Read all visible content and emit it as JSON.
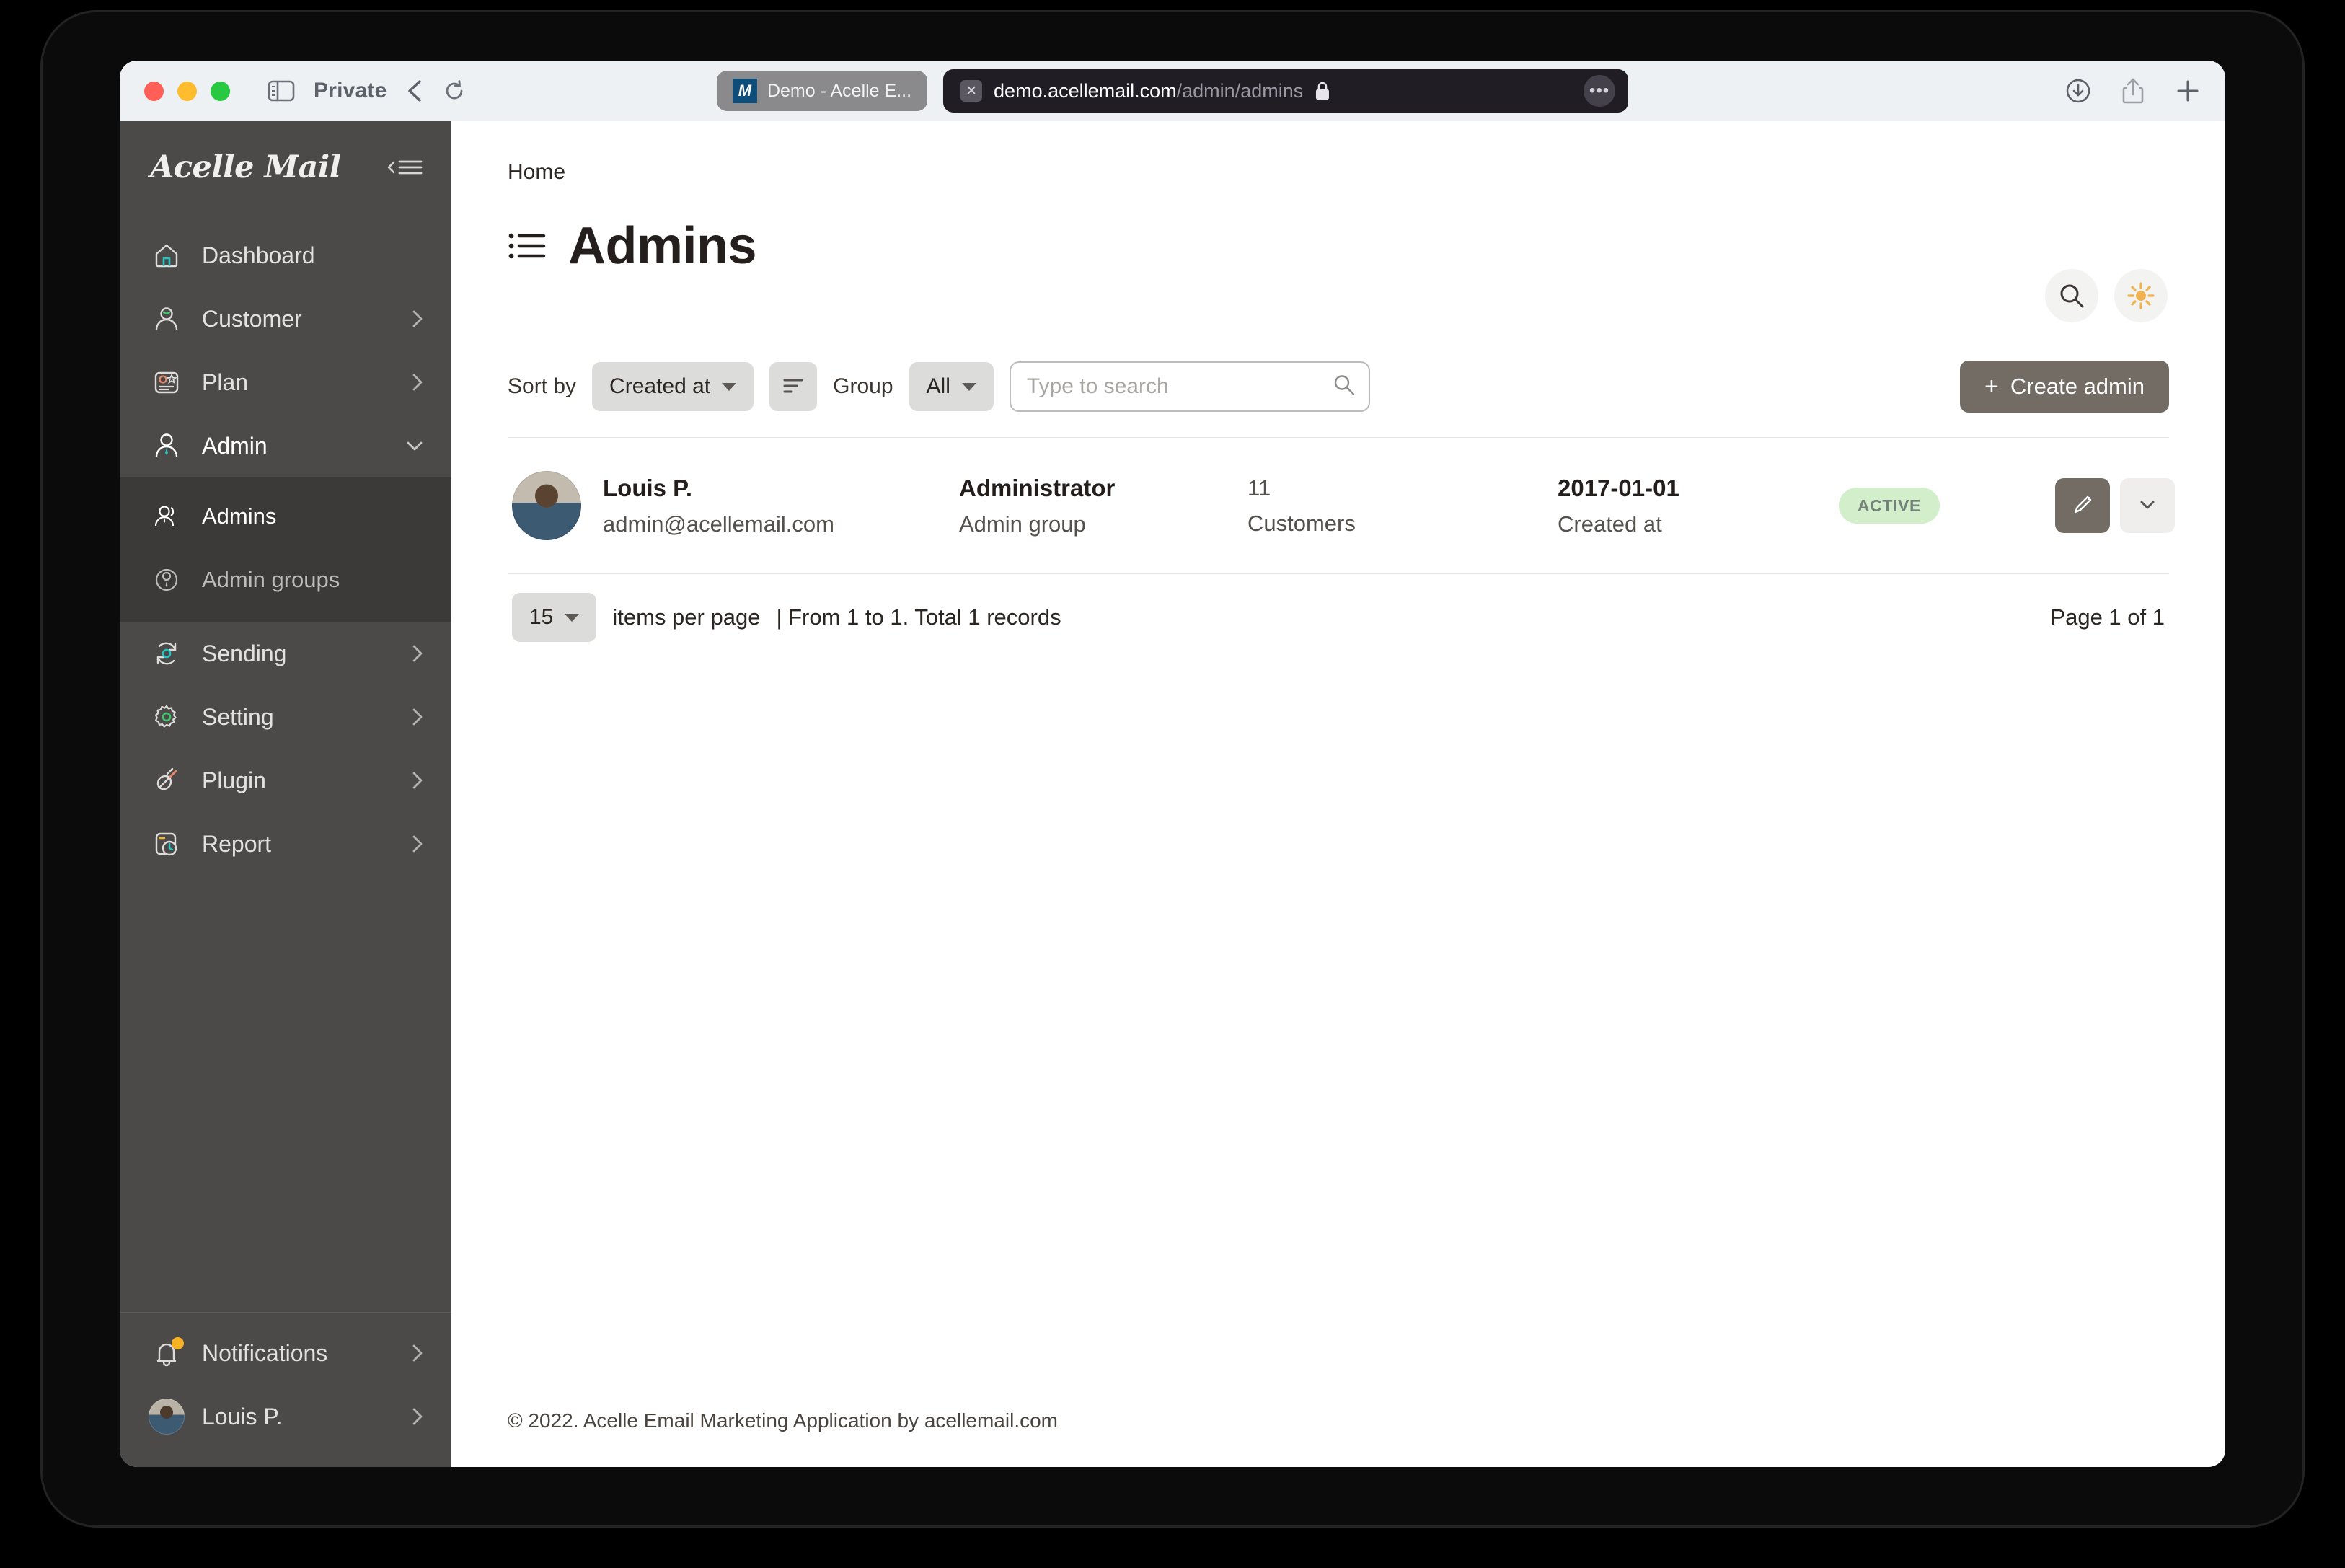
{
  "browser": {
    "private_label": "Private",
    "back_icon": "chevron-left-icon",
    "reload_icon": "reload-icon",
    "sidebar_icon": "sidebar-toggle-icon",
    "tab": {
      "title": "Demo - Acelle E...",
      "favicon_letter": "M"
    },
    "url": {
      "domain": "demo.acellemail.com",
      "path": "/admin/admins",
      "lock_icon": "lock-icon",
      "close_icon": "close-icon",
      "menu_icon": "ellipsis-icon"
    },
    "right_icons": [
      "download-icon",
      "share-icon",
      "new-tab-icon"
    ]
  },
  "sidebar": {
    "brand": "Acelle Mail",
    "collapse_icon": "collapse-sidebar-icon",
    "items": [
      {
        "label": "Dashboard",
        "icon": "home-icon",
        "chevron": ""
      },
      {
        "label": "Customer",
        "icon": "user-icon",
        "chevron": "right"
      },
      {
        "label": "Plan",
        "icon": "plan-card-icon",
        "chevron": "right"
      },
      {
        "label": "Admin",
        "icon": "admin-user-icon",
        "chevron": "down",
        "expanded": true
      },
      {
        "label": "Sending",
        "icon": "sending-sync-icon",
        "chevron": "right"
      },
      {
        "label": "Setting",
        "icon": "gear-icon",
        "chevron": "right"
      },
      {
        "label": "Plugin",
        "icon": "plugin-icon",
        "chevron": "right"
      },
      {
        "label": "Report",
        "icon": "report-clock-icon",
        "chevron": "right"
      }
    ],
    "submenu": [
      {
        "label": "Admins",
        "icon": "admins-icon",
        "active": true
      },
      {
        "label": "Admin groups",
        "icon": "admin-groups-icon",
        "active": false
      }
    ],
    "footer": [
      {
        "label": "Notifications",
        "icon": "bell-icon",
        "chevron": "right",
        "badge": true
      },
      {
        "label": "Louis P.",
        "icon": "avatar",
        "chevron": "right"
      }
    ]
  },
  "header": {
    "breadcrumb": "Home",
    "title": "Admins",
    "title_icon": "list-icon",
    "search_icon": "search-icon",
    "theme_icon": "sun-icon"
  },
  "toolbar": {
    "sort_label": "Sort by",
    "sort_value": "Created at",
    "sort_order_icon": "sort-descending-icon",
    "group_label": "Group",
    "group_value": "All",
    "search_placeholder": "Type to search",
    "search_value": "",
    "create_label": "Create admin",
    "create_plus": "+"
  },
  "table": {
    "rows": [
      {
        "name": "Louis P.",
        "email": "admin@acellemail.com",
        "role": "Administrator",
        "role_sub": "Admin group",
        "count": "11",
        "count_sub": "Customers",
        "date": "2017-01-01",
        "date_sub": "Created at",
        "status": "ACTIVE",
        "edit_icon": "pencil-icon",
        "more_icon": "chevron-down-icon"
      }
    ]
  },
  "pagination": {
    "per_page": "15",
    "per_page_label": "items per page",
    "range_text": "| From 1 to 1. Total 1 records",
    "page_text": "Page 1 of 1"
  },
  "footer": {
    "copyright": "© 2022. Acelle Email Marketing Application by acellemail.com"
  }
}
